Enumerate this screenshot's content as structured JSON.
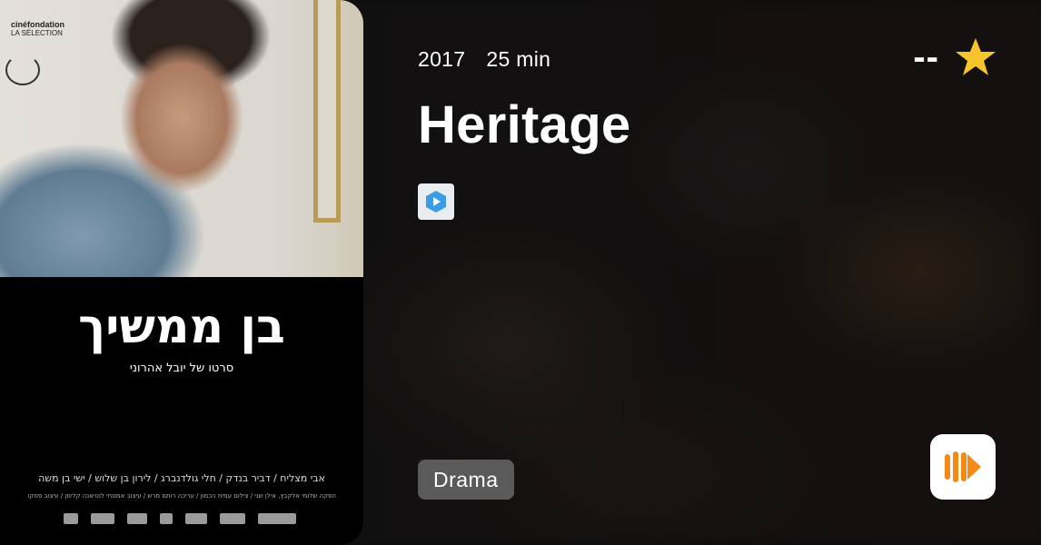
{
  "movie": {
    "year": "2017",
    "duration": "25 min",
    "title": "Heritage",
    "rating": "--",
    "genre": "Drama"
  },
  "poster": {
    "festival_logo": "cinéfondation",
    "festival_sub": "LA SÉLECTION",
    "title_hebrew": "בן ממשיך",
    "subtitle_hebrew": "סרטו של יובל אהרוני",
    "cast_hebrew": "אבי מצליח / דביר בנדק / חלי גולדנברג / לירון בן שלוש / ישי בן משה",
    "credits_hebrew": "הפקה שלומי אלקבץ, אילן שני / צילום עמית הכמון / עריכה רותם מרש / עיצוב אמנותי לוטיאנה קלימן / עיצוב פסקול איציק כהן"
  },
  "icons": {
    "rating": "star-icon",
    "provider": "play-icon",
    "app": "app-logo-icon"
  },
  "colors": {
    "star": "#F7C52B",
    "provider_play": "#3B9BE3",
    "app_logo": "#F48A16"
  }
}
